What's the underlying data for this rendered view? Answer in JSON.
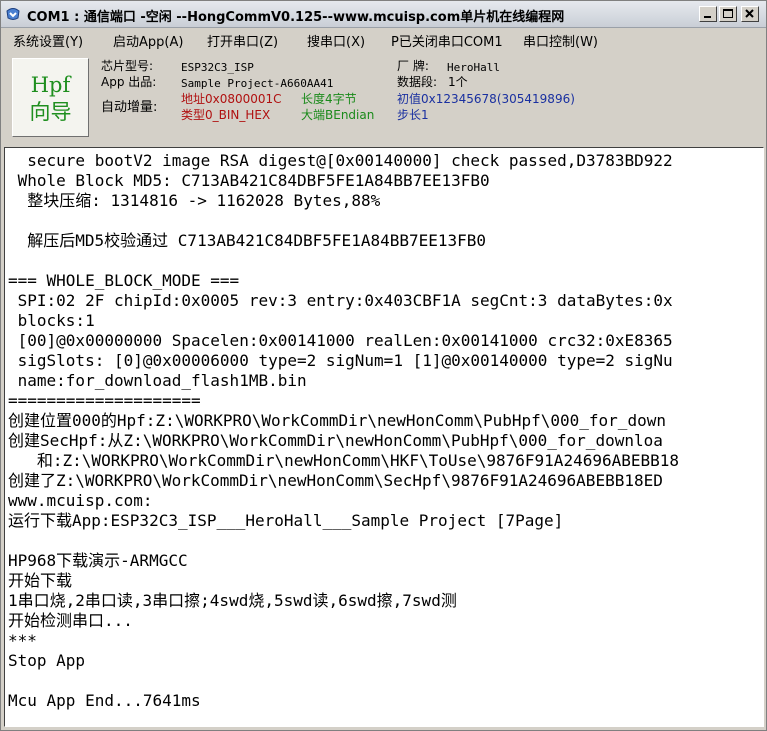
{
  "titlebar": {
    "title": "COM1 : 通信端口 -空闲  --HongCommV0.125--www.mcuisp.com单片机在线编程网",
    "minimize_symbol": "_",
    "maximize_symbol": "□",
    "close_symbol": "×"
  },
  "menu": {
    "items": [
      {
        "label": "系统设置(Y)"
      },
      {
        "label": "启动App(A)"
      },
      {
        "label": "打开串口(Z)"
      },
      {
        "label": "搜串口(X)"
      },
      {
        "label": "P已关闭串口COM1"
      },
      {
        "label": "串口控制(W)"
      }
    ]
  },
  "hpf": {
    "line1": "Hpf",
    "line2": "向导"
  },
  "info": {
    "chip_label": "芯片型号:",
    "chip_value": "ESP32C3_ISP",
    "vendor_label": "厂  牌:",
    "vendor_value": "HeroHall",
    "app_label": "App 出品:",
    "app_value": "Sample Project-A660AA41",
    "segments_label": "数据段:",
    "segments_value": "1个",
    "auto_inc_label": "自动增量:",
    "address": "地址0x0800001C",
    "length": "长度4字节",
    "initial": "初值0x12345678(305419896)",
    "type": "类型0_BIN_HEX",
    "endian": "大端BEndian",
    "step": "步长1"
  },
  "colors": {
    "address": "#b01010",
    "length": "#1a8a1a",
    "initial": "#1a30a0",
    "type": "#b01010",
    "endian": "#1a8a1a",
    "step": "#1a30a0",
    "hpf_text": "#1f8f1f"
  },
  "console": {
    "lines": [
      "  secure bootV2 image RSA digest@[0x00140000] check passed,D3783BD922",
      " Whole Block MD5: C713AB421C84DBF5FE1A84BB7EE13FB0",
      "  整块压缩: 1314816 -> 1162028 Bytes,88%",
      "",
      "  解压后MD5校验通过 C713AB421C84DBF5FE1A84BB7EE13FB0",
      "",
      "=== WHOLE_BLOCK_MODE ===",
      " SPI:02 2F chipId:0x0005 rev:3 entry:0x403CBF1A segCnt:3 dataBytes:0x",
      " blocks:1",
      " [00]@0x00000000 Spacelen:0x00141000 realLen:0x00141000 crc32:0xE8365",
      " sigSlots: [0]@0x00006000 type=2 sigNum=1 [1]@0x00140000 type=2 sigNu",
      " name:for_download_flash1MB.bin",
      "====================",
      "创建位置000的Hpf:Z:\\WORKPRO\\WorkCommDir\\newHonComm\\PubHpf\\000_for_down",
      "创建SecHpf:从Z:\\WORKPRO\\WorkCommDir\\newHonComm\\PubHpf\\000_for_downloa",
      "   和:Z:\\WORKPRO\\WorkCommDir\\newHonComm\\HKF\\ToUse\\9876F91A24696ABEBB18",
      "创建了Z:\\WORKPRO\\WorkCommDir\\newHonComm\\SecHpf\\9876F91A24696ABEBB18ED",
      "www.mcuisp.com:",
      "运行下载App:ESP32C3_ISP___HeroHall___Sample Project [7Page]",
      "",
      "HP968下载演示-ARMGCC",
      "开始下载",
      "1串口烧,2串口读,3串口擦;4swd烧,5swd读,6swd擦,7swd测",
      "开始检测串口...",
      "***",
      "Stop App",
      "",
      "Mcu App End...7641ms"
    ]
  }
}
